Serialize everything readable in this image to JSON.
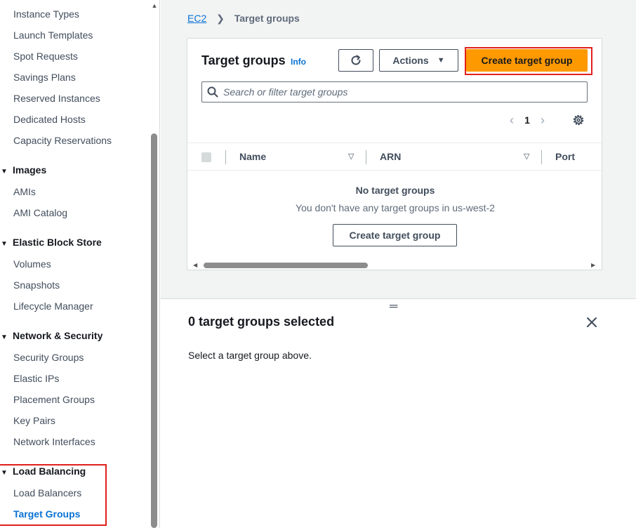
{
  "sidebar": {
    "items": [
      {
        "label": "Instance Types"
      },
      {
        "label": "Launch Templates"
      },
      {
        "label": "Spot Requests"
      },
      {
        "label": "Savings Plans"
      },
      {
        "label": "Reserved Instances"
      },
      {
        "label": "Dedicated Hosts"
      },
      {
        "label": "Capacity Reservations"
      }
    ],
    "sections": [
      {
        "title": "Images",
        "items": [
          {
            "label": "AMIs"
          },
          {
            "label": "AMI Catalog"
          }
        ]
      },
      {
        "title": "Elastic Block Store",
        "items": [
          {
            "label": "Volumes"
          },
          {
            "label": "Snapshots"
          },
          {
            "label": "Lifecycle Manager"
          }
        ]
      },
      {
        "title": "Network & Security",
        "items": [
          {
            "label": "Security Groups"
          },
          {
            "label": "Elastic IPs"
          },
          {
            "label": "Placement Groups"
          },
          {
            "label": "Key Pairs"
          },
          {
            "label": "Network Interfaces"
          }
        ]
      },
      {
        "title": "Load Balancing",
        "items": [
          {
            "label": "Load Balancers"
          },
          {
            "label": "Target Groups"
          }
        ]
      }
    ],
    "active_item": "Target Groups"
  },
  "breadcrumb": {
    "root": "EC2",
    "current": "Target groups"
  },
  "panel": {
    "title": "Target groups",
    "info": "Info",
    "actions_label": "Actions",
    "create_label": "Create target group",
    "search_placeholder": "Search or filter target groups",
    "page": "1",
    "columns": [
      "Name",
      "ARN",
      "Port"
    ],
    "empty_title": "No target groups",
    "empty_desc": "You don't have any target groups in us-west-2",
    "empty_create_label": "Create target group"
  },
  "split": {
    "title": "0 target groups selected",
    "desc": "Select a target group above."
  },
  "colors": {
    "accent": "#0972d3",
    "primary_button": "#ff9900",
    "highlight": "#e0201b"
  }
}
